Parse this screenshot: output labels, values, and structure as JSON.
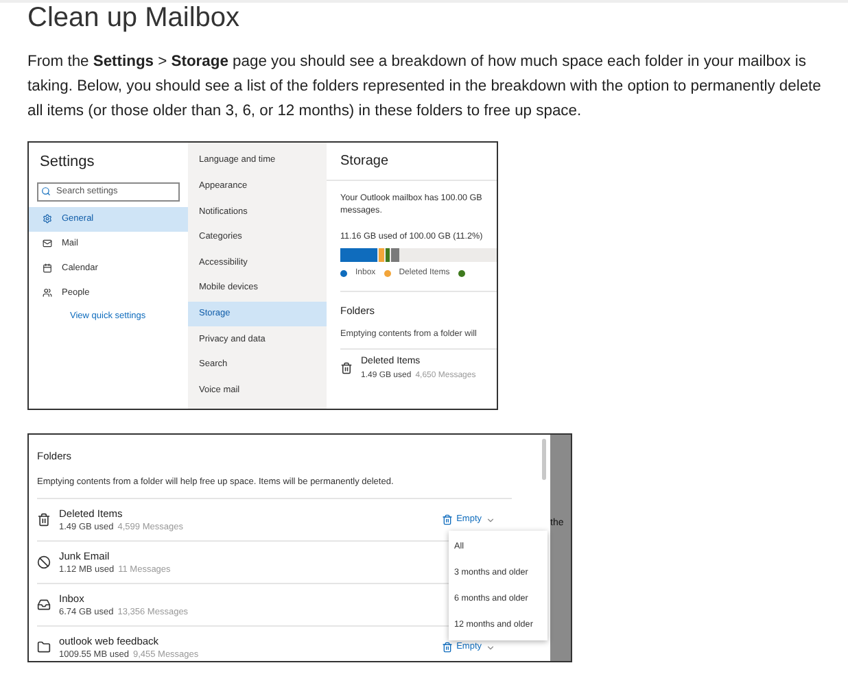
{
  "heading": "Clean up Mailbox",
  "intro": "From the **Settings** > **Storage** page you should see a breakdown of how much space each folder in your mailbox is taking. Below, you should see a list of the folders represented in the breakdown with the option to permanently delete all items (or those older than 3, 6, or 12 months) in these folders to free up space.",
  "settings_screenshot": {
    "title": "Settings",
    "search": {
      "placeholder": "Search settings"
    },
    "nav": [
      {
        "label": "General",
        "selected": true
      },
      {
        "label": "Mail",
        "selected": false
      },
      {
        "label": "Calendar",
        "selected": false
      },
      {
        "label": "People",
        "selected": false
      }
    ],
    "quick_link": "View quick settings",
    "subnav": [
      {
        "label": "Language and time",
        "selected": false
      },
      {
        "label": "Appearance",
        "selected": false
      },
      {
        "label": "Notifications",
        "selected": false
      },
      {
        "label": "Categories",
        "selected": false
      },
      {
        "label": "Accessibility",
        "selected": false
      },
      {
        "label": "Mobile devices",
        "selected": false
      },
      {
        "label": "Storage",
        "selected": true
      },
      {
        "label": "Privacy and data",
        "selected": false
      },
      {
        "label": "Search",
        "selected": false
      },
      {
        "label": "Voice mail",
        "selected": false
      }
    ],
    "storage": {
      "title": "Storage",
      "lines": [
        "Your Outlook mailbox has 100.00 GB",
        "messages."
      ],
      "usage": "11.16 GB used of 100.00 GB (11.2%)",
      "segments": [
        {
          "color": "#0f6cbd"
        },
        {
          "color": "#f2a53a"
        },
        {
          "color": "#3f7a1e"
        },
        {
          "color": "#7a7a7a"
        }
      ],
      "legend": [
        {
          "label": "Inbox",
          "color": "#0f6cbd"
        },
        {
          "label": "Deleted Items",
          "color": "#f2a53a"
        },
        {
          "color": "#3f7a1e"
        }
      ],
      "folders_title": "Folders",
      "folders_text": "Emptying contents from a folder will",
      "folder": {
        "name": "Deleted Items",
        "size": "1.49 GB used",
        "count": "4,650 Messages"
      }
    }
  },
  "folders_screenshot": {
    "title": "Folders",
    "description": "Emptying contents from a folder will help free up space. Items will be permanently deleted.",
    "folders": [
      {
        "name": "Deleted Items",
        "size": "1.49 GB used",
        "count": "4,599 Messages",
        "action": "Empty"
      },
      {
        "name": "Junk Email",
        "size": "1.12 MB used",
        "count": "11 Messages"
      },
      {
        "name": "Inbox",
        "size": "6.74 GB used",
        "count": "13,356 Messages"
      },
      {
        "name": "outlook web feedback",
        "size": "1009.55 MB used",
        "count": "9,455 Messages",
        "action": "Empty"
      }
    ],
    "menu": [
      "All",
      "3 months and older",
      "6 months and older",
      "12 months and older"
    ],
    "side_text": "the"
  }
}
